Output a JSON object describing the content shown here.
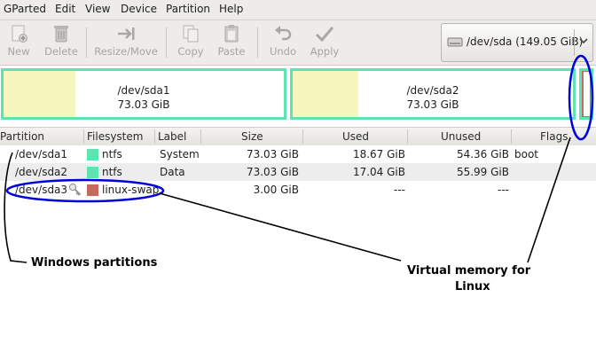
{
  "menubar": {
    "items": [
      "GParted",
      "Edit",
      "View",
      "Device",
      "Partition",
      "Help"
    ]
  },
  "toolbar": {
    "buttons": [
      {
        "label": "New",
        "icon": "new-icon"
      },
      {
        "label": "Delete",
        "icon": "delete-icon"
      },
      {
        "label": "Resize/Move",
        "icon": "resize-move-icon"
      },
      {
        "label": "Copy",
        "icon": "copy-icon"
      },
      {
        "label": "Paste",
        "icon": "paste-icon"
      },
      {
        "label": "Undo",
        "icon": "undo-icon"
      },
      {
        "label": "Apply",
        "icon": "apply-icon"
      }
    ],
    "device": "/dev/sda  (149.05 GiB)"
  },
  "partition_map": [
    {
      "name": "/dev/sda1",
      "size": "73.03 GiB",
      "used_fraction": 0.256
    },
    {
      "name": "/dev/sda2",
      "size": "73.03 GiB",
      "used_fraction": 0.233
    }
  ],
  "list": {
    "headers": [
      "Partition",
      "Filesystem",
      "Label",
      "Size",
      "Used",
      "Unused",
      "Flags"
    ],
    "rows": [
      {
        "partition": "/dev/sda1",
        "filesystem": "ntfs",
        "fs_color": "#5fe3b0",
        "label": "System",
        "size": "73.03 GiB",
        "used": "18.67 GiB",
        "unused": "54.36 GiB",
        "flags": "boot"
      },
      {
        "partition": "/dev/sda2",
        "filesystem": "ntfs",
        "fs_color": "#5fe3b0",
        "label": "Data",
        "size": "73.03 GiB",
        "used": "17.04 GiB",
        "unused": "55.99 GiB",
        "flags": ""
      },
      {
        "partition": "/dev/sda3",
        "filesystem": "linux-swap",
        "fs_color": "#c46a5e",
        "label": "",
        "size": "3.00 GiB",
        "used": "---",
        "unused": "---",
        "flags": ""
      }
    ]
  },
  "annotations": {
    "windows": "Windows partitions",
    "virtual_line1": "Virtual memory for",
    "virtual_line2": "Linux",
    "ink_color": "#0000dd"
  }
}
